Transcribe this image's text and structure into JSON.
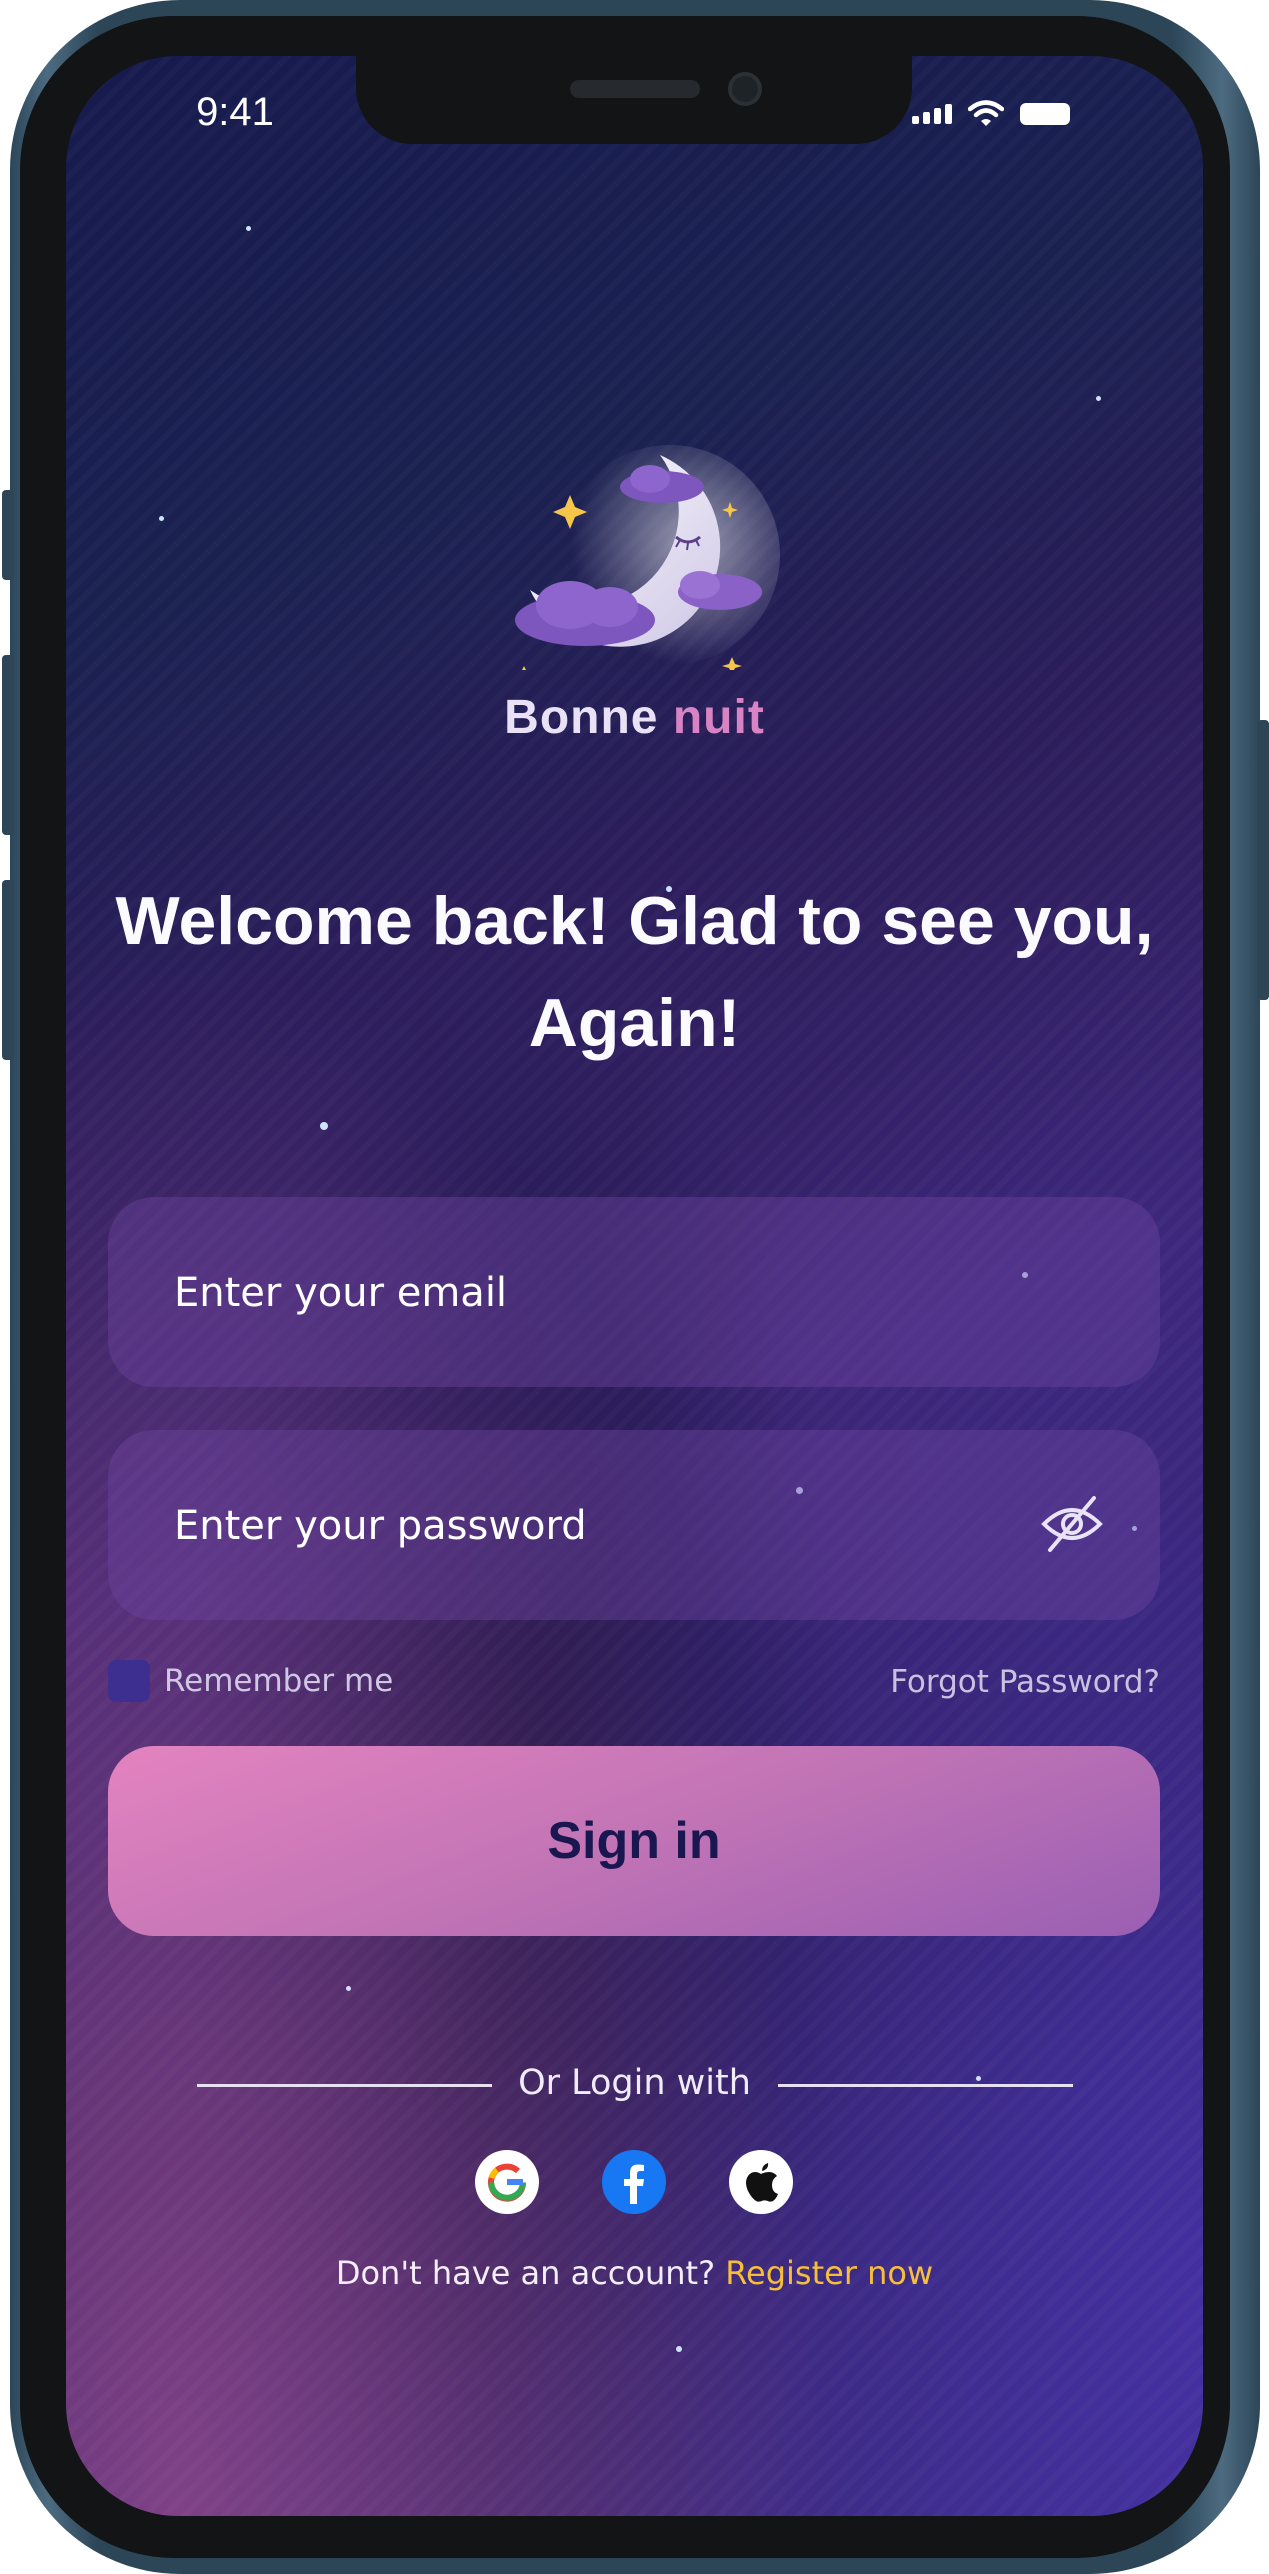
{
  "status_bar": {
    "time": "9:41"
  },
  "brand": {
    "name_part1": "Bonne",
    "name_part2": "nuit"
  },
  "headline": "Welcome back! Glad to see you, Again!",
  "email_field": {
    "placeholder": "Enter your email",
    "value": ""
  },
  "password_field": {
    "placeholder": "Enter your password",
    "value": "",
    "toggle_icon": "eye-off-icon"
  },
  "remember": {
    "label": "Remember me",
    "checked": false
  },
  "forgot_password": "Forgot Password?",
  "sign_in_label": "Sign in",
  "social": {
    "divider_text": "Or Login with",
    "providers": [
      "google-icon",
      "facebook-icon",
      "apple-icon"
    ]
  },
  "register": {
    "question": "Don't have an account?",
    "link": "Register now"
  },
  "colors": {
    "accent_pink": "#d884c4",
    "link_yellow": "#f6be3a",
    "button_text": "#1a1650"
  }
}
